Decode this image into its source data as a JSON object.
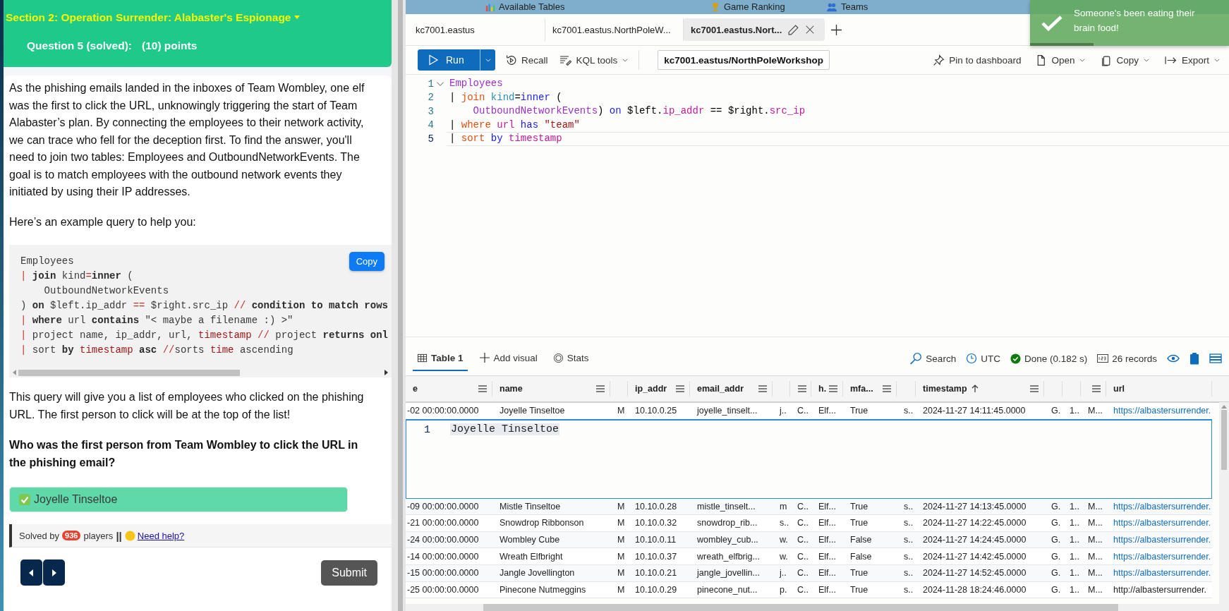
{
  "quiz": {
    "section_title": "Section 2: Operation Surrender: Alabaster's Espionage",
    "question_label": "Question 5 (solved):",
    "points": "(10) points",
    "intro": "As the phishing emails landed in the inboxes of Team Wombley, one elf was the first to click the URL, unknowingly triggering the start of Team Alabaster’s plan. By connecting the employees to their network activity, we can trace who fell for the deception first. To find the answer, you'll need to join two tables: Employees and OutboundNetworkEvents. The goal is to match employees with the outbound network events they initiated by using their IP addresses.",
    "example_label": "Here’s an example query to help you:",
    "code": {
      "copy_button": "Copy",
      "lines": [
        [
          {
            "text": "Employees",
            "kind": "plain"
          }
        ],
        [
          {
            "text": "| ",
            "kind": "operator"
          },
          {
            "text": "join",
            "kind": "keyword"
          },
          {
            "text": " kind",
            "kind": "plain"
          },
          {
            "text": "=",
            "kind": "operator"
          },
          {
            "text": "inner",
            "kind": "keyword"
          },
          {
            "text": " (",
            "kind": "plain"
          }
        ],
        [
          {
            "text": "    OutboundNetworkEvents",
            "kind": "plain"
          }
        ],
        [
          {
            "text": ") ",
            "kind": "plain"
          },
          {
            "text": "on",
            "kind": "keyword"
          },
          {
            "text": " $left.ip_addr ",
            "kind": "plain"
          },
          {
            "text": "==",
            "kind": "operator"
          },
          {
            "text": " $right.src_ip ",
            "kind": "plain"
          },
          {
            "text": "//",
            "kind": "operator"
          },
          {
            "text": " condition to match rows",
            "kind": "keyword"
          }
        ],
        [
          {
            "text": "| ",
            "kind": "operator"
          },
          {
            "text": "where",
            "kind": "keyword"
          },
          {
            "text": " url ",
            "kind": "plain"
          },
          {
            "text": "contains",
            "kind": "keyword"
          },
          {
            "text": " \"< maybe a filename :) >\"",
            "kind": "plain"
          }
        ],
        [
          {
            "text": "| ",
            "kind": "operator"
          },
          {
            "text": "project name, ip_addr, url, ",
            "kind": "plain"
          },
          {
            "text": "timestamp",
            "kind": "type"
          },
          {
            "text": " //",
            "kind": "operator"
          },
          {
            "text": " project ",
            "kind": "plain"
          },
          {
            "text": "returns onl",
            "kind": "keyword"
          }
        ],
        [
          {
            "text": "| ",
            "kind": "operator"
          },
          {
            "text": "sort ",
            "kind": "plain"
          },
          {
            "text": "by",
            "kind": "keyword"
          },
          {
            "text": " timestamp",
            "kind": "type"
          },
          {
            "text": " asc",
            "kind": "keyword"
          },
          {
            "text": " //",
            "kind": "operator"
          },
          {
            "text": "sorts ",
            "kind": "plain"
          },
          {
            "text": "time",
            "kind": "type"
          },
          {
            "text": " ascending",
            "kind": "plain"
          }
        ]
      ]
    },
    "explanation": "This query will give you a list of employees who clicked on the phishing URL. The first person to click will be at the top of the list!",
    "question": "Who was the first person from Team Wombley to click the URL in the phishing email?",
    "answer": {
      "value": "Joyelle Tinseltoe",
      "correct": true
    },
    "solved_by": {
      "prefix": "Solved by",
      "count": "936",
      "suffix": "players",
      "separator": "||",
      "help_link": "Need help?"
    },
    "submit_button": "Submit"
  },
  "nav_tabs": [
    {
      "label": "Available Tables",
      "kind": "chart"
    },
    {
      "label": "Game Ranking",
      "kind": "trophy"
    },
    {
      "label": "Teams",
      "kind": "people"
    }
  ],
  "toast": {
    "message": "Someone's been eating their brain food!"
  },
  "query_tabs": [
    {
      "label": "kc7001.eastus",
      "selected": false
    },
    {
      "label": "kc7001.eastus.NorthPoleW...",
      "selected": false
    },
    {
      "label": "kc7001.eastus.Nort...",
      "selected": true
    }
  ],
  "toolbar": {
    "run": "Run",
    "recall": "Recall",
    "kql_tools": "KQL tools",
    "database": "kc7001.eastus/NorthPoleWorkshop",
    "actions": [
      {
        "label": "Pin to dashboard",
        "kind": "pin",
        "dropdown": false
      },
      {
        "label": "Open",
        "kind": "file",
        "dropdown": true
      },
      {
        "label": "Copy",
        "kind": "copy",
        "dropdown": true
      },
      {
        "label": "Export",
        "kind": "export",
        "dropdown": true
      }
    ]
  },
  "editor": {
    "lines": [
      {
        "number": "1",
        "current": false,
        "tokens": [
          {
            "text": "Employees",
            "kind": "table"
          }
        ]
      },
      {
        "number": "2",
        "current": false,
        "tokens": [
          {
            "text": "| ",
            "kind": "plain"
          },
          {
            "text": "join ",
            "kind": "command"
          },
          {
            "text": "kind",
            "kind": "param"
          },
          {
            "text": "=",
            "kind": "plain"
          },
          {
            "text": "inner",
            "kind": "keyword"
          },
          {
            "text": " (",
            "kind": "plain"
          }
        ]
      },
      {
        "number": "3",
        "current": false,
        "tokens": [
          {
            "text": "    OutboundNetworkEvents",
            "kind": "table"
          },
          {
            "text": ") ",
            "kind": "plain"
          },
          {
            "text": "on",
            "kind": "keyword"
          },
          {
            "text": " $left.",
            "kind": "plain"
          },
          {
            "text": "ip_addr",
            "kind": "column"
          },
          {
            "text": " == $right.",
            "kind": "plain"
          },
          {
            "text": "src_ip",
            "kind": "column"
          }
        ]
      },
      {
        "number": "4",
        "current": false,
        "tokens": [
          {
            "text": "| ",
            "kind": "plain"
          },
          {
            "text": "where ",
            "kind": "command"
          },
          {
            "text": "url ",
            "kind": "column"
          },
          {
            "text": "has ",
            "kind": "keyword"
          },
          {
            "text": "\"team\"",
            "kind": "string"
          }
        ]
      },
      {
        "number": "5",
        "current": true,
        "tokens": [
          {
            "text": "| ",
            "kind": "plain"
          },
          {
            "text": "sort ",
            "kind": "command"
          },
          {
            "text": "by ",
            "kind": "keyword"
          },
          {
            "text": "timestamp",
            "kind": "column"
          }
        ]
      }
    ]
  },
  "results": {
    "tabs": [
      {
        "label": "Table 1",
        "kind": "table",
        "selected": true
      },
      {
        "label": "Add visual",
        "kind": "add",
        "selected": false
      },
      {
        "label": "Stats",
        "kind": "stats",
        "selected": false
      }
    ],
    "search": "Search",
    "timezone": "UTC",
    "status": "Done (0.182 s)",
    "records": "26 records",
    "columns": [
      {
        "header": "e",
        "menu": true
      },
      {
        "header": "name",
        "menu": true
      },
      {
        "menu": false
      },
      {
        "header": "ip_addr",
        "menu": true
      },
      {
        "header": "email_addr",
        "menu": true
      },
      {
        "menu": false
      },
      {
        "menu": true
      },
      {
        "header": "h.",
        "menu": true
      },
      {
        "header": "mfa...",
        "menu": true
      },
      {
        "menu": false
      },
      {
        "header": "timestamp",
        "menu": true,
        "sorted_ascending": true
      },
      {
        "menu": false
      },
      {
        "menu": false
      },
      {
        "menu": true
      },
      {
        "header": "url",
        "menu": false
      }
    ],
    "rows": [
      {
        "expanded": true,
        "link": true,
        "detail": {
          "line_number": "1",
          "value": "Joyelle Tinseltoe"
        },
        "cells": [
          "-02 00:00:00.0000",
          "Joyelle Tinseltoe",
          "M",
          "10.10.0.25",
          "joyelle_tinselt...",
          "j..",
          "C..",
          "Elf...",
          "True",
          "s..",
          "2024-11-27 14:11:45.0000",
          "G.",
          "1..",
          "M...",
          "https://albastersurrender."
        ]
      },
      {
        "expanded": false,
        "link": true,
        "cells": [
          "-09 00:00:00.0000",
          "Mistle Tinseltoe",
          "M",
          "10.10.0.28",
          "mistle_tinselt...",
          "m",
          "C..",
          "Elf...",
          "True",
          "s..",
          "2024-11-27 14:13:45.0000",
          "G.",
          "1..",
          "M...",
          "https://albastersurrender."
        ]
      },
      {
        "expanded": false,
        "link": true,
        "cells": [
          "-21 00:00:00.0000",
          "Snowdrop Ribbonson",
          "M",
          "10.10.0.32",
          "snowdrop_rib...",
          "s..",
          "C..",
          "Elf...",
          "True",
          "s..",
          "2024-11-27 14:22:45.0000",
          "G.",
          "1..",
          "M...",
          "https://albastersurrender."
        ]
      },
      {
        "expanded": false,
        "link": true,
        "cells": [
          "-24 00:00:00.0000",
          "Wombley Cube",
          "M",
          "10.10.0.11",
          "wombley_cub...",
          "w.",
          "C..",
          "Elf...",
          "False",
          "s..",
          "2024-11-27 14:24:45.0000",
          "G.",
          "1..",
          "M...",
          "https://albastersurrender."
        ]
      },
      {
        "expanded": false,
        "link": true,
        "cells": [
          "-14 00:00:00.0000",
          "Wreath Elfbright",
          "M",
          "10.10.0.37",
          "wreath_elfbrig...",
          "w.",
          "C..",
          "Elf...",
          "False",
          "s..",
          "2024-11-27 14:42:45.0000",
          "G.",
          "1..",
          "M...",
          "https://albastersurrender."
        ]
      },
      {
        "expanded": false,
        "link": true,
        "cells": [
          "-15 00:00:00.0000",
          "Jangle Jovellington",
          "M",
          "10.10.0.21",
          "jangle_jovellin...",
          "j..",
          "C..",
          "Elf...",
          "True",
          "s..",
          "2024-11-27 14:52:45.0000",
          "G.",
          "1..",
          "M...",
          "https://albastersurrender."
        ]
      },
      {
        "expanded": false,
        "link": false,
        "cells": [
          "-25 00:00:00.0000",
          "Pinecone Nutmeggins",
          "M",
          "10.10.0.29",
          "pinecone_nut...",
          "p.",
          "C..",
          "Elf...",
          "True",
          "s..",
          "2024-11-28 18:24:46.0000",
          "G.",
          "1..",
          "M...",
          "http://albastersurrender."
        ]
      }
    ]
  }
}
